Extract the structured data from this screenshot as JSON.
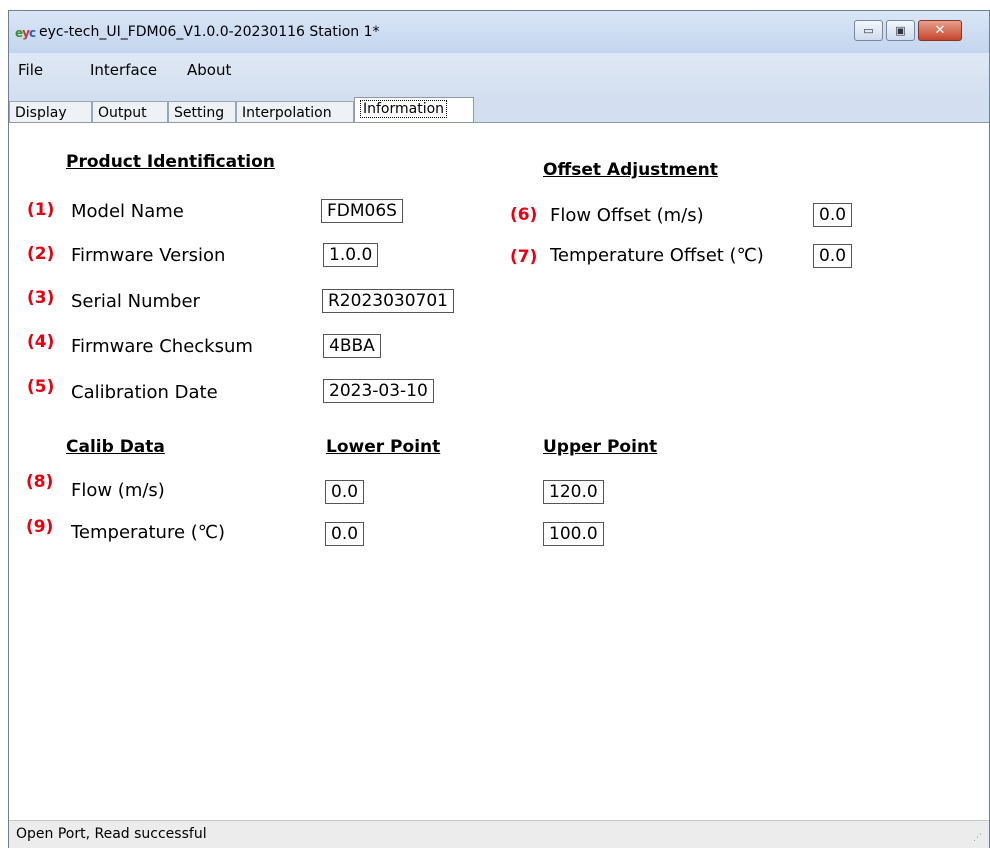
{
  "titlebar": {
    "title": "eyc-tech_UI_FDM06_V1.0.0-20230116  Station 1*",
    "min_glyph": "▭",
    "max_glyph": "▣",
    "close_glyph": "✕"
  },
  "menu": {
    "file": "File",
    "interface": "Interface",
    "about": "About"
  },
  "tabs": [
    "Display",
    "Output",
    "Setting",
    "Interpolation",
    "Information"
  ],
  "product": {
    "heading": "Product Identification",
    "rows": [
      {
        "num": "(1)",
        "label": "Model Name",
        "value": "FDM06S"
      },
      {
        "num": "(2)",
        "label": "Firmware Version",
        "value": "1.0.0"
      },
      {
        "num": "(3)",
        "label": "Serial Number",
        "value": "R2023030701"
      },
      {
        "num": "(4)",
        "label": "Firmware Checksum",
        "value": "4BBA"
      },
      {
        "num": "(5)",
        "label": "Calibration Date",
        "value": "2023-03-10"
      }
    ]
  },
  "offset": {
    "heading": "Offset Adjustment",
    "rows": [
      {
        "num": "(6)",
        "label": "Flow Offset (m/s)",
        "value": "0.0"
      },
      {
        "num": "(7)",
        "label": "Temperature Offset (℃)",
        "value": "0.0"
      }
    ]
  },
  "calib": {
    "heading": "Calib Data",
    "lower_heading": "Lower Point",
    "upper_heading": "Upper Point",
    "rows": [
      {
        "num": "(8)",
        "label": "Flow (m/s)",
        "lower": "0.0",
        "upper": "120.0"
      },
      {
        "num": "(9)",
        "label": "Temperature (℃)",
        "lower": "0.0",
        "upper": "100.0"
      }
    ]
  },
  "status": {
    "text": "Open Port,   Read successful",
    "grip_glyph": "⋰"
  },
  "colors": {
    "annotation": "#e60012",
    "titlebar": "#c3d5ee",
    "close_button": "#c6452c"
  }
}
